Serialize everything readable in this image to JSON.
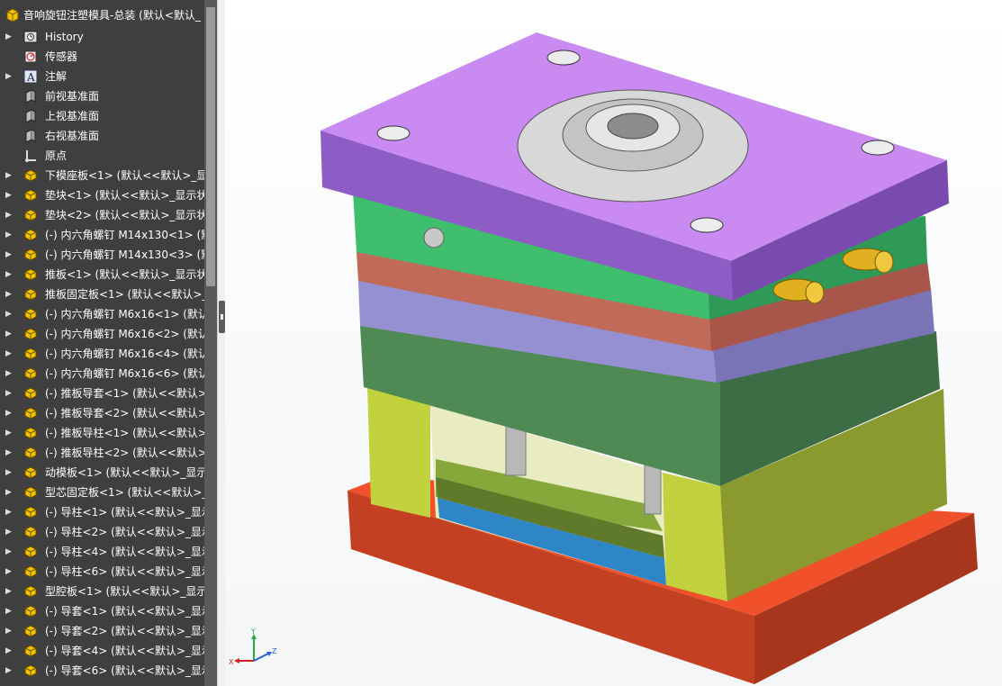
{
  "tree": {
    "root": "音响旋钮注塑模具-总装 (默认<默认_",
    "items": [
      {
        "label": "History",
        "icon": "history-icon",
        "arrow": true
      },
      {
        "label": "传感器",
        "icon": "sensor-icon",
        "arrow": false
      },
      {
        "label": "注解",
        "icon": "annotation-icon",
        "arrow": true
      },
      {
        "label": "前视基准面",
        "icon": "plane-icon",
        "arrow": false
      },
      {
        "label": "上视基准面",
        "icon": "plane-icon",
        "arrow": false
      },
      {
        "label": "右视基准面",
        "icon": "plane-icon",
        "arrow": false
      },
      {
        "label": "原点",
        "icon": "origin-icon",
        "arrow": false
      },
      {
        "label": "下模座板<1> (默认<<默认>_显",
        "icon": "part-icon",
        "arrow": true
      },
      {
        "label": "垫块<1> (默认<<默认>_显示状",
        "icon": "part-icon",
        "arrow": true
      },
      {
        "label": "垫块<2> (默认<<默认>_显示状",
        "icon": "part-icon",
        "arrow": true
      },
      {
        "label": "(-) 内六角螺钉 M14x130<1> (默",
        "icon": "part-icon",
        "arrow": true
      },
      {
        "label": "(-) 内六角螺钉 M14x130<3> (默",
        "icon": "part-icon",
        "arrow": true
      },
      {
        "label": "推板<1> (默认<<默认>_显示状",
        "icon": "part-icon",
        "arrow": true
      },
      {
        "label": "推板固定板<1> (默认<<默认>_",
        "icon": "part-icon",
        "arrow": true
      },
      {
        "label": "(-) 内六角螺钉 M6x16<1> (默认",
        "icon": "part-icon",
        "arrow": true
      },
      {
        "label": "(-) 内六角螺钉 M6x16<2> (默认",
        "icon": "part-icon",
        "arrow": true
      },
      {
        "label": "(-) 内六角螺钉 M6x16<4> (默认",
        "icon": "part-icon",
        "arrow": true
      },
      {
        "label": "(-) 内六角螺钉 M6x16<6> (默认",
        "icon": "part-icon",
        "arrow": true
      },
      {
        "label": "(-) 推板导套<1> (默认<<默认>_",
        "icon": "part-icon",
        "arrow": true
      },
      {
        "label": "(-) 推板导套<2> (默认<<默认>_",
        "icon": "part-icon",
        "arrow": true
      },
      {
        "label": "(-) 推板导柱<1> (默认<<默认>_",
        "icon": "part-icon",
        "arrow": true
      },
      {
        "label": "(-) 推板导柱<2> (默认<<默认>_",
        "icon": "part-icon",
        "arrow": true
      },
      {
        "label": "动模板<1> (默认<<默认>_显示",
        "icon": "part-icon",
        "arrow": true
      },
      {
        "label": "型芯固定板<1> (默认<<默认>_",
        "icon": "part-icon",
        "arrow": true
      },
      {
        "label": "(-) 导柱<1> (默认<<默认>_显示",
        "icon": "part-icon",
        "arrow": true
      },
      {
        "label": "(-) 导柱<2> (默认<<默认>_显示",
        "icon": "part-icon",
        "arrow": true
      },
      {
        "label": "(-) 导柱<4> (默认<<默认>_显示",
        "icon": "part-icon",
        "arrow": true
      },
      {
        "label": "(-) 导柱<6> (默认<<默认>_显示",
        "icon": "part-icon",
        "arrow": true
      },
      {
        "label": "型腔板<1> (默认<<默认>_显示",
        "icon": "part-icon",
        "arrow": true
      },
      {
        "label": "(-) 导套<1> (默认<<默认>_显示",
        "icon": "part-icon",
        "arrow": true
      },
      {
        "label": "(-) 导套<2> (默认<<默认>_显示",
        "icon": "part-icon",
        "arrow": true
      },
      {
        "label": "(-) 导套<4> (默认<<默认>_显示",
        "icon": "part-icon",
        "arrow": true
      },
      {
        "label": "(-) 导套<6> (默认<<默认>_显示",
        "icon": "part-icon",
        "arrow": true
      }
    ]
  },
  "triad": {
    "x": "X",
    "y": "Y",
    "z": "Z"
  },
  "colors": {
    "top_plate": "#b06ee0",
    "green_plate": "#3fbe6e",
    "red_plate": "#c87060",
    "lavender_plate": "#9a96d8",
    "dark_green_plate": "#4e8e58",
    "olive": "#b8c93c",
    "base": "#e14a24",
    "blue_plate": "#2f86c6"
  }
}
